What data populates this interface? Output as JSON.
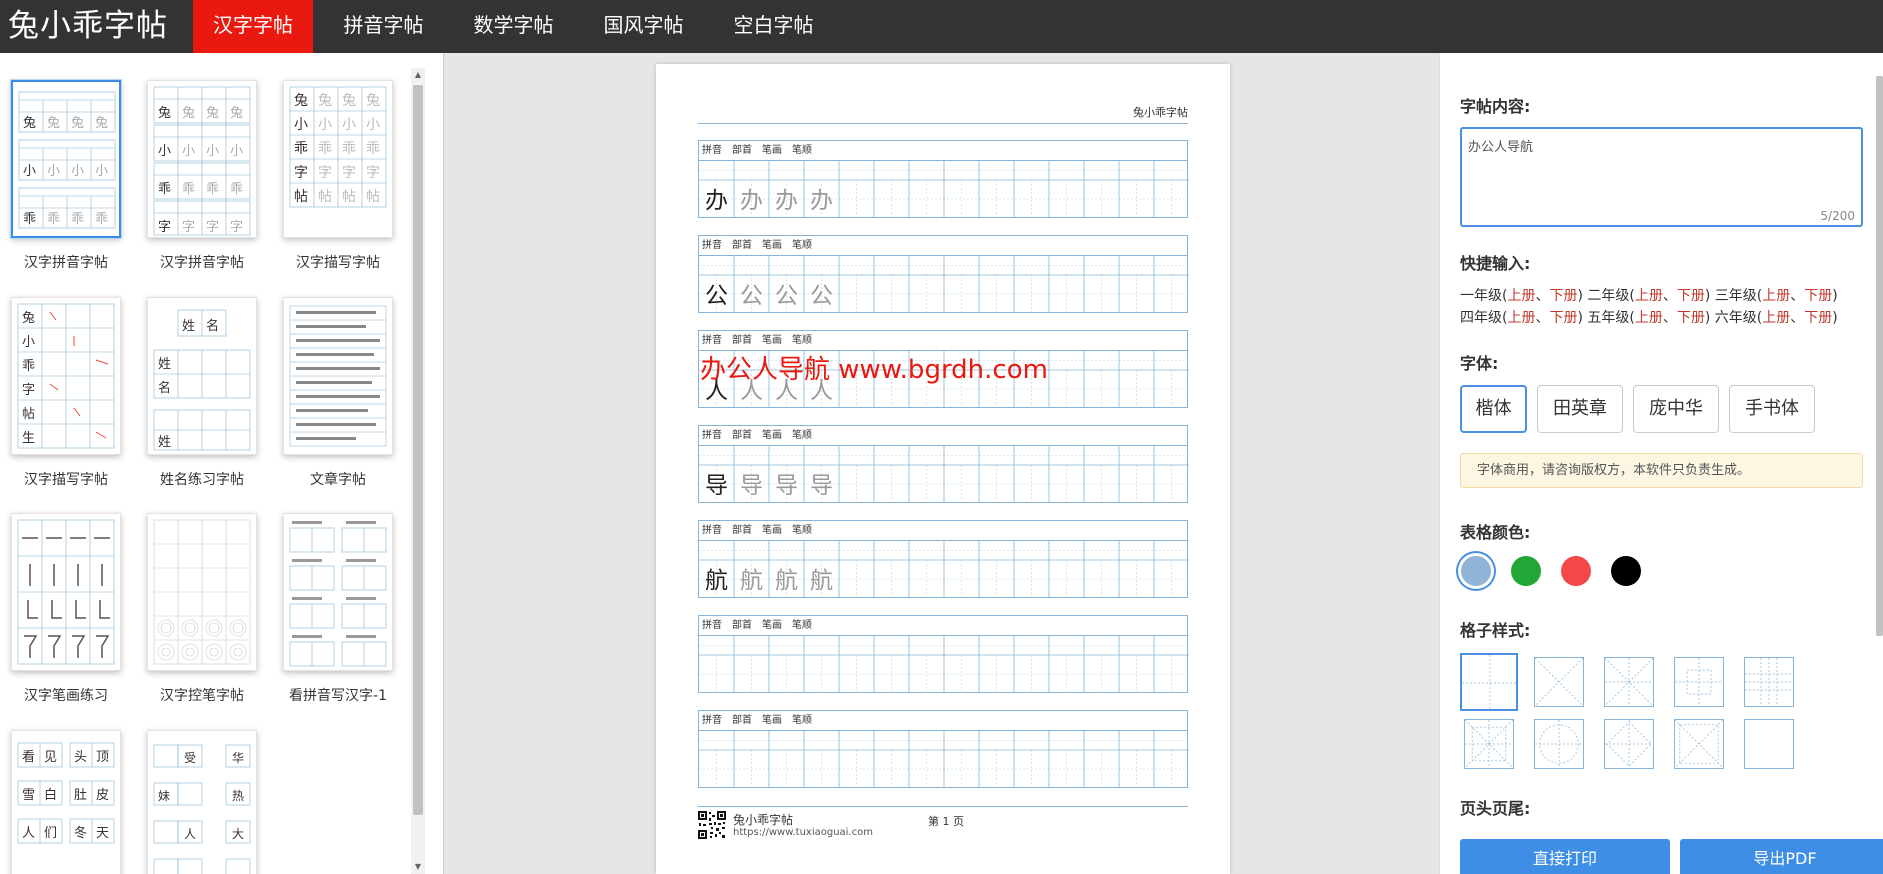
{
  "app": {
    "logo": "兔小乖字帖"
  },
  "nav": {
    "tabs": [
      {
        "label": "汉字字帖",
        "active": true
      },
      {
        "label": "拼音字帖",
        "active": false
      },
      {
        "label": "数学字帖",
        "active": false
      },
      {
        "label": "国风字帖",
        "active": false
      },
      {
        "label": "空白字帖",
        "active": false
      }
    ]
  },
  "templates": [
    {
      "label": "汉字拼音字帖",
      "selected": true
    },
    {
      "label": "汉字拼音字帖",
      "selected": false
    },
    {
      "label": "汉字描写字帖",
      "selected": false
    },
    {
      "label": "汉字描写字帖",
      "selected": false
    },
    {
      "label": "姓名练习字帖",
      "selected": false
    },
    {
      "label": "文章字帖",
      "selected": false
    },
    {
      "label": "汉字笔画练习",
      "selected": false
    },
    {
      "label": "汉字控笔字帖",
      "selected": false
    },
    {
      "label": "看拼音写汉字-1",
      "selected": false
    },
    {
      "label": "",
      "selected": false
    },
    {
      "label": "",
      "selected": false
    }
  ],
  "preview": {
    "header": "兔小乖字帖",
    "row_fields": [
      "拼音",
      "部首",
      "笔画",
      "笔顺"
    ],
    "characters": [
      "办",
      "公",
      "人",
      "导",
      "航",
      "",
      ""
    ],
    "watermark": "办公人导航 www.bgrdh.com",
    "footer": {
      "name": "兔小乖字帖",
      "url": "https://www.tuxiaoguai.com",
      "page": "第 1 页"
    }
  },
  "settings": {
    "content_title": "字帖内容:",
    "content_value": "办公人导航",
    "content_counter": "5/200",
    "quick_title": "快捷输入:",
    "quick_rows": [
      [
        {
          "grade": "一年级",
          "up": "上册",
          "down": "下册"
        },
        {
          "grade": "二年级",
          "up": "上册",
          "down": "下册"
        },
        {
          "grade": "三年级",
          "up": "上册",
          "down": "下册"
        }
      ],
      [
        {
          "grade": "四年级",
          "up": "上册",
          "down": "下册"
        },
        {
          "grade": "五年级",
          "up": "上册",
          "down": "下册"
        },
        {
          "grade": "六年级",
          "up": "上册",
          "down": "下册"
        }
      ]
    ],
    "font_title": "字体:",
    "fonts": [
      {
        "label": "楷体",
        "active": true
      },
      {
        "label": "田英章",
        "active": false
      },
      {
        "label": "庞中华",
        "active": false
      },
      {
        "label": "手书体",
        "active": false
      }
    ],
    "font_notice": "字体商用，请咨询版权方，本软件只负责生成。",
    "color_title": "表格颜色:",
    "colors": [
      {
        "name": "blue",
        "hex": "#8fb4d6",
        "selected": true
      },
      {
        "name": "green",
        "hex": "#21a637",
        "selected": false
      },
      {
        "name": "red",
        "hex": "#f24848",
        "selected": false
      },
      {
        "name": "black",
        "hex": "#000000",
        "selected": false
      }
    ],
    "grid_title": "格子样式:",
    "grid_styles": [
      {
        "name": "tian-grid",
        "selected": true
      },
      {
        "name": "mi-grid",
        "selected": false
      },
      {
        "name": "mi-grid-fine",
        "selected": false
      },
      {
        "name": "hui-grid",
        "selected": false
      },
      {
        "name": "jiugong-grid",
        "selected": false
      },
      {
        "name": "star-grid",
        "selected": false
      },
      {
        "name": "circle-grid",
        "selected": false
      },
      {
        "name": "diamond-grid",
        "selected": false
      },
      {
        "name": "cross-grid",
        "selected": false
      },
      {
        "name": "blank-grid",
        "selected": false
      }
    ],
    "header_footer_title": "页头页尾:",
    "print_button": "直接打印",
    "export_button": "导出PDF"
  },
  "accent_colors": {
    "nav_active": "#e9190f",
    "primary": "#3f8ee5",
    "grid_line": "#86b4d6"
  }
}
